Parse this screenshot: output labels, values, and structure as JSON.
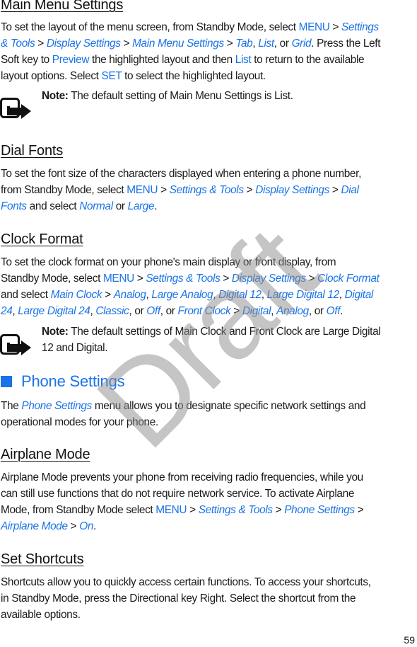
{
  "sections": {
    "main_menu": {
      "title": "Main Menu Settings",
      "lines": [
        [
          "To set the layout of the menu screen, from Standby Mode, select ",
          "MENU",
          " > ",
          "Settings"
        ],
        [
          "& Tools",
          " > ",
          "Display Settings",
          " > ",
          "Main Menu Settings",
          " > ",
          "Tab",
          ", ",
          "List",
          ", or ",
          "Grid",
          ". Press the Left"
        ],
        [
          "Soft key to ",
          "Preview",
          " the highlighted layout and then ",
          "List",
          " to return to the available"
        ],
        [
          "layout options. Select ",
          "SET",
          " to select the highlighted layout."
        ]
      ],
      "note_label": "Note:",
      "note_text": " The default setting of Main Menu Settings is List."
    },
    "dial_fonts": {
      "title": "Dial Fonts",
      "line1": "To set the font size of the characters displayed when entering a phone number,",
      "line2_pre": "from Standby Mode, select ",
      "menu": "MENU",
      "sep": " > ",
      "path1": "Settings & Tools",
      "path2": "Display Settings",
      "path3a": "Dial",
      "path3b": "Fonts",
      "and_select": " and select ",
      "opt1": "Normal",
      "or": " or ",
      "opt2": "Large",
      "end": "."
    },
    "clock_format": {
      "title": "Clock Format",
      "line1": "To set the clock format on your phone's main display or front display, from",
      "line2_pre": "Standby Mode, select ",
      "menu": "MENU",
      "path1": "Settings & Tools",
      "path2": "Display Settings",
      "path3": "Clock Format",
      "and_select": "and select ",
      "main_clock": "Main Clock",
      "options_main": [
        "Analog",
        "Large Analog",
        "Digital 12",
        "Large Digital 12",
        "Digital 24",
        "Large Digital 24",
        "Classic",
        "Off"
      ],
      "front_clock": "Front Clock",
      "options_front": [
        "Digital",
        "Analog",
        "Off"
      ],
      "note_label": "Note:",
      "note_line1": " The default settings of Main Clock and Front Clock are Large Digital",
      "note_line2": "12 and Digital."
    },
    "phone_settings": {
      "title": "Phone Settings",
      "line1_pre": "The ",
      "link": "Phone Settings",
      "line1_post": " menu allows you to designate specific network settings and",
      "line2": "operational modes for your phone."
    },
    "airplane_mode": {
      "title": "Airplane Mode",
      "line1": "Airplane Mode prevents your phone from receiving radio frequencies, while you",
      "line2": "can still use functions that do not require network service. To activate Airplane",
      "line3_pre": "Mode, from Standby Mode select ",
      "menu": "MENU",
      "path1": "Settings & Tools",
      "path2": "Phone Settings",
      "path3": "Airplane Mode",
      "path4": "On"
    },
    "set_shortcuts": {
      "title": "Set Shortcuts",
      "line1": "Shortcuts allow you to quickly access certain functions. To access your shortcuts,",
      "line2": "in Standby Mode, press the Directional key Right. Select the shortcut from the",
      "line3": "available options."
    }
  },
  "page_number": "59",
  "watermark": "Draft",
  "icons": {
    "note": "note-icon",
    "section_marker": "section-square-icon"
  },
  "colors": {
    "accent": "#1a73e8",
    "text": "#1a1a1a",
    "watermark": "#8c8c8c"
  }
}
